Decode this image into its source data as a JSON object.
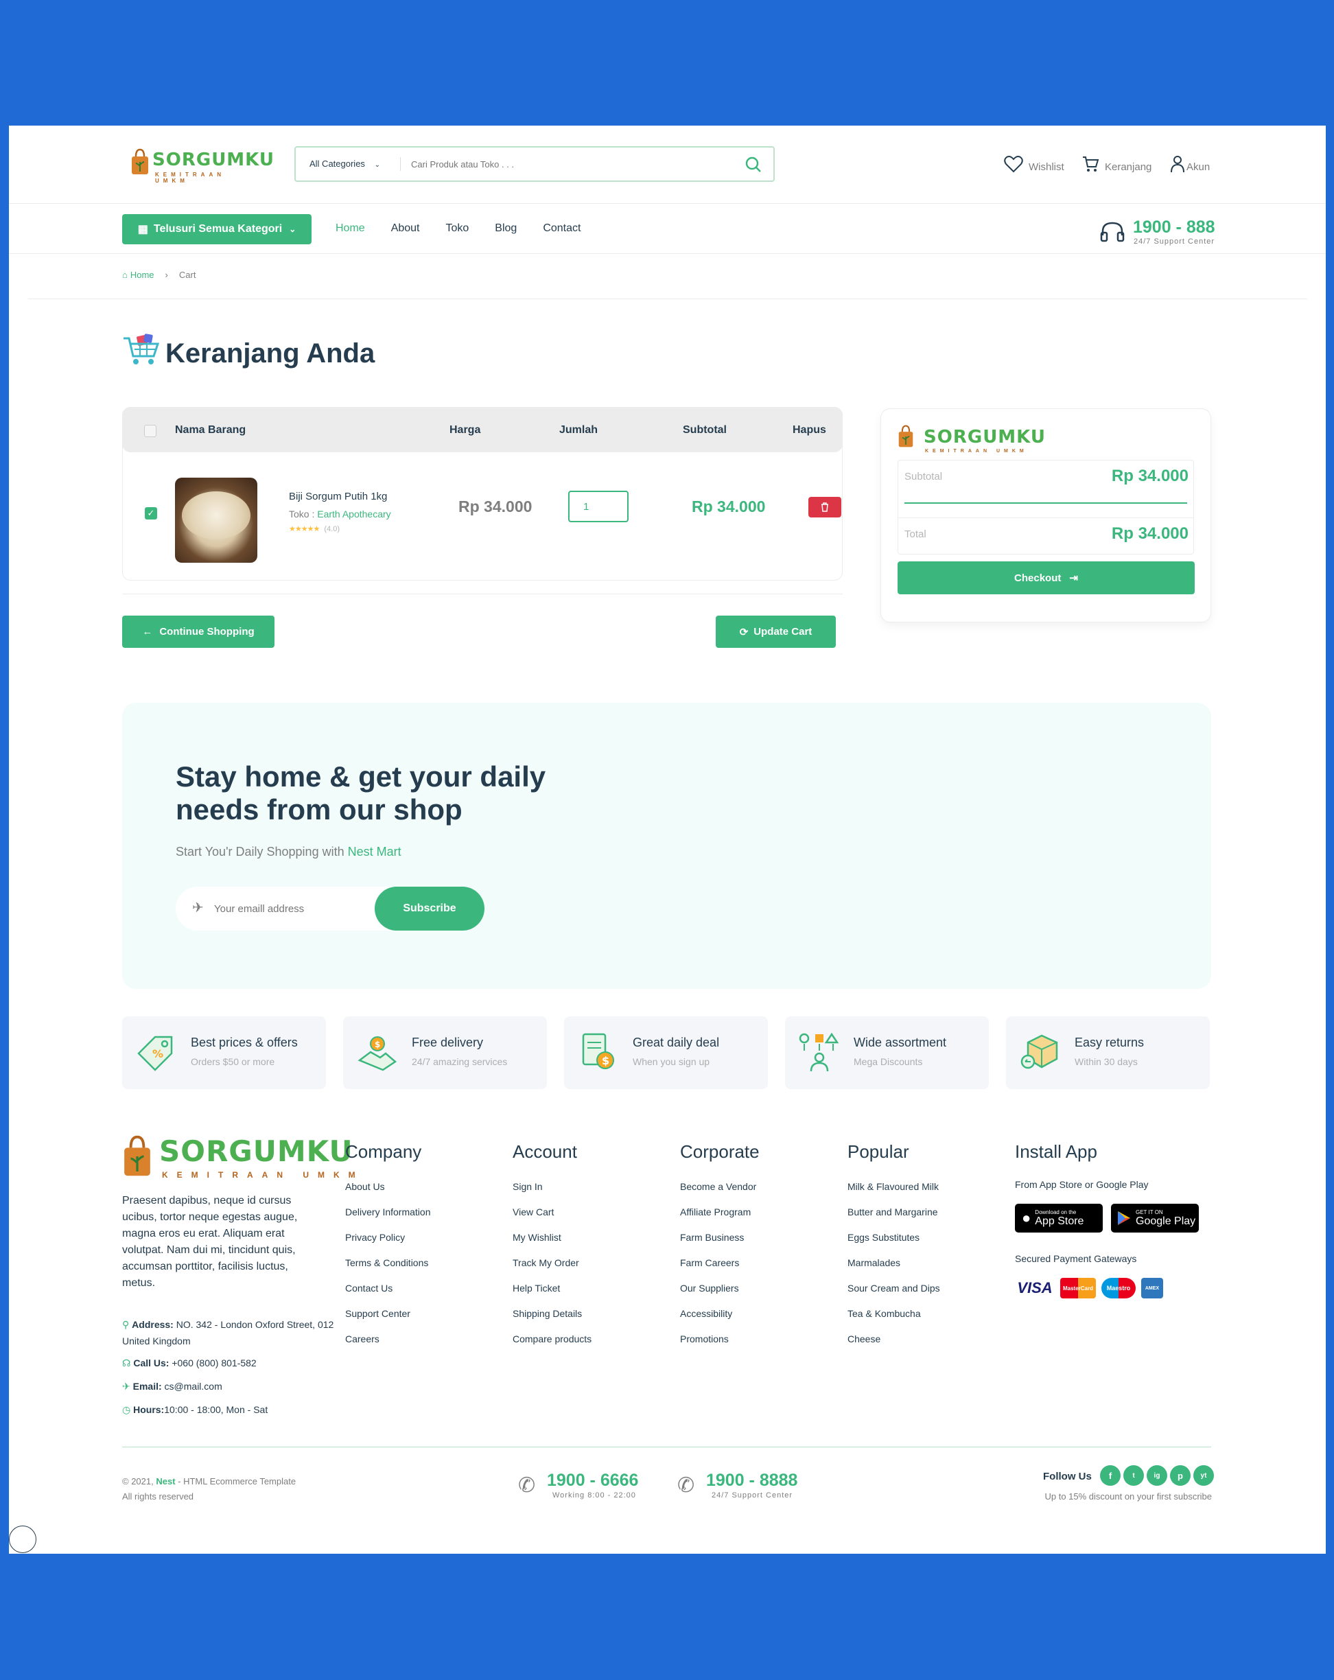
{
  "brand": {
    "name": "SORGUMKU",
    "tagline": "KEMITRAAN UMKM",
    "color": "#3bb77e",
    "logo_icon": "shopping-bag-plant-icon"
  },
  "search": {
    "category": "All Categories",
    "placeholder": "Cari Produk atau Toko . . ."
  },
  "header_actions": {
    "wishlist": "Wishlist",
    "cart": "Keranjang",
    "account": "Akun"
  },
  "nav": {
    "browse": "Telusuri Semua Kategori",
    "items": [
      "Home",
      "About",
      "Toko",
      "Blog",
      "Contact"
    ],
    "phone": "1900 - 888",
    "support": "24/7 Support Center"
  },
  "breadcrumb": {
    "home": "Home",
    "current": "Cart"
  },
  "page_title": "Keranjang Anda",
  "cart": {
    "headers": [
      "Nama Barang",
      "Harga",
      "Jumlah",
      "Subtotal",
      "Hapus"
    ],
    "item": {
      "name": "Biji Sorgum Putih 1kg",
      "store_label": "Toko : ",
      "store": "Earth Apothecary",
      "rating_stars": "★★★★★",
      "rating_value": 4.0,
      "rating": "(4.0)",
      "price": "Rp 34.000",
      "quantity": "1",
      "subtotal": "Rp 34.000",
      "checked": true
    },
    "continue": "Continue Shopping",
    "update": "Update Cart"
  },
  "summary": {
    "subtotal_label": "Subtotal",
    "subtotal": "Rp 34.000",
    "total_label": "Total",
    "total": "Rp 34.000",
    "checkout": "Checkout"
  },
  "newsletter": {
    "title_line1": "Stay home & get your daily",
    "title_line2": "needs from our shop",
    "subtitle_prefix": "Start You'r Daily Shopping with ",
    "subtitle_link": "Nest Mart",
    "placeholder": "Your emaill address",
    "button": "Subscribe"
  },
  "features": [
    {
      "title": "Best prices & offers",
      "sub": "Orders $50 or more",
      "icon": "price-tag-icon"
    },
    {
      "title": "Free delivery",
      "sub": "24/7 amazing services",
      "icon": "delivery-icon"
    },
    {
      "title": "Great daily deal",
      "sub": "When you sign up",
      "icon": "deal-icon"
    },
    {
      "title": "Wide assortment",
      "sub": "Mega Discounts",
      "icon": "assortment-icon"
    },
    {
      "title": "Easy returns",
      "sub": "Within 30 days",
      "icon": "returns-icon"
    }
  ],
  "footer": {
    "about": "Praesent dapibus, neque id cursus ucibus, tortor neque egestas augue, magna eros eu erat. Aliquam erat volutpat. Nam dui mi, tincidunt quis, accumsan porttitor, facilisis luctus, metus.",
    "address_label": "Address:",
    "address": " NO. 342 - London Oxford Street, 012 United Kingdom",
    "call_label": "Call Us:",
    "call": "+060 (800) 801-582",
    "email_label": "Email:",
    "email": " cs@mail.com",
    "hours_label": "Hours:",
    "hours": "10:00 - 18:00, Mon - Sat",
    "columns": [
      {
        "title": "Company",
        "links": [
          "About Us",
          "Delivery Information",
          "Privacy Policy",
          "Terms & Conditions",
          "Contact Us",
          "Support Center",
          "Careers"
        ]
      },
      {
        "title": "Account",
        "links": [
          "Sign In",
          "View Cart",
          "My Wishlist",
          "Track My Order",
          "Help Ticket",
          "Shipping Details",
          "Compare products"
        ]
      },
      {
        "title": "Corporate",
        "links": [
          "Become a Vendor",
          "Affiliate Program",
          "Farm Business",
          "Farm Careers",
          "Our Suppliers",
          "Accessibility",
          "Promotions"
        ]
      },
      {
        "title": "Popular",
        "links": [
          "Milk & Flavoured Milk",
          "Butter and Margarine",
          "Eggs Substitutes",
          "Marmalades",
          "Sour Cream and Dips",
          "Tea & Kombucha",
          "Cheese"
        ]
      }
    ],
    "install": {
      "title": "Install App",
      "sub": "From App Store or Google Play",
      "appstore_small": "Download on the",
      "appstore": "App Store",
      "googleplay_small": "GET IT ON",
      "googleplay": "Google Play",
      "secured": "Secured Payment Gateways",
      "payments": [
        "VISA",
        "MasterCard",
        "Maestro",
        "AMEX"
      ]
    },
    "copyright_year": "© 2021, ",
    "copyright_brand": "Nest",
    "copyright_rest": " - HTML Ecommerce Template",
    "rights": "All rights reserved",
    "phone1": "1900 - 6666",
    "phone1_sub": "Working 8:00 - 22:00",
    "phone2": "1900 - 8888",
    "phone2_sub": "24/7 Support Center",
    "follow": "Follow Us",
    "follow_sub": "Up to 15% discount on your first subscribe",
    "socials": [
      "f",
      "t",
      "ig",
      "p",
      "yt"
    ]
  }
}
